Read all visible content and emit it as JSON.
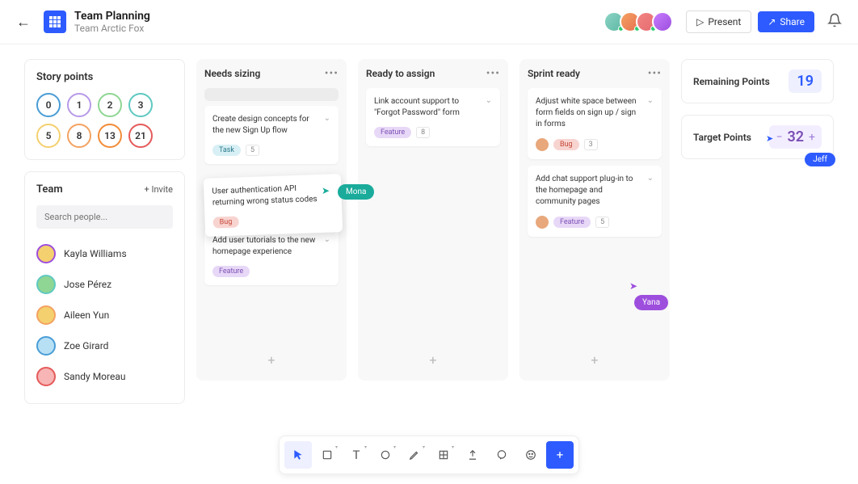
{
  "header": {
    "title": "Team Planning",
    "subtitle": "Team Arctic Fox",
    "present": "Present",
    "share": "Share"
  },
  "story": {
    "title": "Story points",
    "chips": [
      {
        "v": "0",
        "c": "#4a9dd6"
      },
      {
        "v": "1",
        "c": "#b89ae8"
      },
      {
        "v": "2",
        "c": "#8fd694"
      },
      {
        "v": "3",
        "c": "#5fc9c1"
      },
      {
        "v": "5",
        "c": "#f4d06f"
      },
      {
        "v": "8",
        "c": "#f4a261"
      },
      {
        "v": "13",
        "c": "#f28c38"
      },
      {
        "v": "21",
        "c": "#e55a5a"
      }
    ]
  },
  "team": {
    "title": "Team",
    "invite": "+ Invite",
    "search_ph": "Search people...",
    "members": [
      {
        "name": "Kayla Williams",
        "c": "#9d4edd",
        "bg": "#f4d06f"
      },
      {
        "name": "Jose Pérez",
        "c": "#5fc9c1",
        "bg": "#8fd694"
      },
      {
        "name": "Aileen Yun",
        "c": "#f4a261",
        "bg": "#f4d06f"
      },
      {
        "name": "Zoe Girard",
        "c": "#4a9dd6",
        "bg": "#b8e0f5"
      },
      {
        "name": "Sandy Moreau",
        "c": "#e55a5a",
        "bg": "#f7b5b5"
      }
    ]
  },
  "columns": [
    {
      "title": "Needs sizing",
      "placeholder": true,
      "tasks": [
        {
          "desc": "Create design concepts for the new Sign Up flow",
          "tag": "Task",
          "tagcls": "tag-task",
          "num": "5"
        },
        {
          "desc": "Add user tutorials to the new homepage experience",
          "tag": "Feature",
          "tagcls": "tag-feature"
        }
      ]
    },
    {
      "title": "Ready to assign",
      "tasks": [
        {
          "desc": "Link account support to \"Forgot Password\" form",
          "tag": "Feature",
          "tagcls": "tag-feature",
          "num": "8"
        }
      ]
    },
    {
      "title": "Sprint ready",
      "tasks": [
        {
          "desc": "Adjust white space between form fields on sign up / sign in forms",
          "tag": "Bug",
          "tagcls": "tag-bug",
          "num": "3",
          "av": true
        },
        {
          "desc": "Add chat support plug-in to the homepage and community pages",
          "tag": "Feature",
          "tagcls": "tag-feature",
          "num": "5",
          "av": true
        }
      ]
    }
  ],
  "drag_task": {
    "desc": "User authentication API returning wrong status codes",
    "tag": "Bug",
    "tagcls": "tag-bug"
  },
  "stats": {
    "remaining_label": "Remaining Points",
    "remaining_val": "19",
    "target_label": "Target Points",
    "target_val": "32"
  },
  "cursors": {
    "mona": "Mona",
    "yana": "Yana",
    "jeff": "Jeff"
  },
  "tools": [
    "pointer",
    "sticky",
    "text",
    "shape",
    "pen",
    "grid",
    "upload",
    "comment",
    "stamp",
    "add"
  ]
}
